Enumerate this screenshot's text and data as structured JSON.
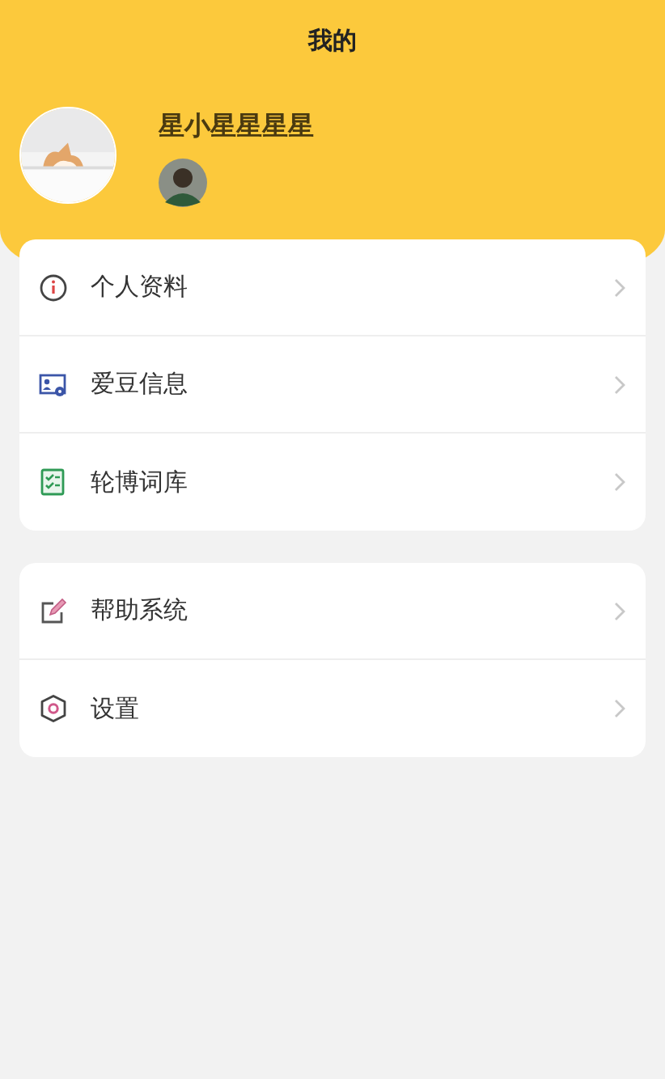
{
  "header": {
    "title": "我的"
  },
  "profile": {
    "name": "星小星星星星"
  },
  "menu_groups": [
    {
      "items": [
        {
          "label": "个人资料"
        },
        {
          "label": "爱豆信息"
        },
        {
          "label": "轮博词库"
        }
      ]
    },
    {
      "items": [
        {
          "label": "帮助系统"
        },
        {
          "label": "设置"
        }
      ]
    }
  ]
}
